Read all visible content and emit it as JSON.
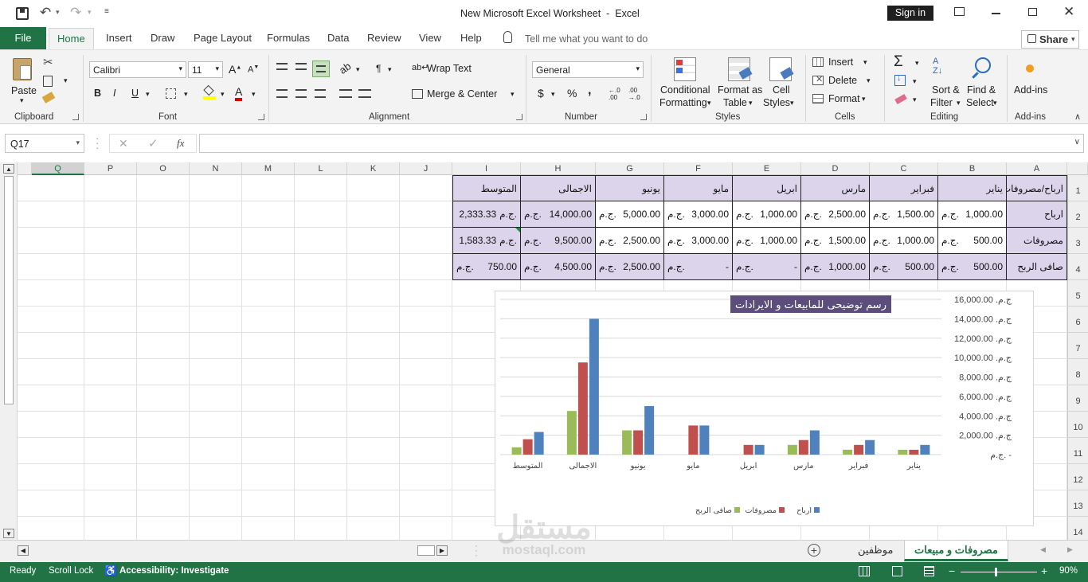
{
  "window": {
    "title": "New Microsoft Excel Worksheet  -  Excel",
    "sign_in": "Sign in"
  },
  "ribbon_tabs": [
    "File",
    "Home",
    "Insert",
    "Draw",
    "Page Layout",
    "Formulas",
    "Data",
    "Review",
    "View",
    "Help"
  ],
  "tell_me": "Tell me what you want to do",
  "share": "Share",
  "ribbon": {
    "clipboard": {
      "paste": "Paste",
      "label": "Clipboard"
    },
    "font": {
      "name": "Calibri",
      "size": "11",
      "label": "Font"
    },
    "alignment": {
      "wrap": "Wrap Text",
      "merge": "Merge & Center",
      "label": "Alignment"
    },
    "number": {
      "format": "General",
      "label": "Number",
      "currency": "$",
      "percent": "%",
      "comma": ","
    },
    "styles": {
      "conditional_1": "Conditional",
      "conditional_2": "Formatting",
      "format_table_1": "Format as",
      "format_table_2": "Table",
      "cell_styles_1": "Cell",
      "cell_styles_2": "Styles",
      "label": "Styles"
    },
    "cells": {
      "insert": "Insert",
      "delete": "Delete",
      "format": "Format",
      "label": "Cells"
    },
    "editing": {
      "sort_1": "Sort &",
      "sort_2": "Filter",
      "find_1": "Find &",
      "find_2": "Select",
      "label": "Editing"
    },
    "addins": {
      "name": "Add-ins",
      "label": "Add-ins"
    }
  },
  "formula_bar": {
    "name_box": "Q17",
    "fx": "fx",
    "value": ""
  },
  "columns": [
    "Q",
    "P",
    "O",
    "N",
    "M",
    "L",
    "K",
    "J",
    "I",
    "H",
    "G",
    "F",
    "E",
    "D",
    "C",
    "B",
    "A"
  ],
  "rows": [
    "1",
    "2",
    "3",
    "4",
    "5",
    "6",
    "7",
    "8",
    "9",
    "10",
    "11",
    "12",
    "13",
    "14"
  ],
  "table": {
    "header": [
      "ارباح/مصروفات",
      "يناير",
      "فبراير",
      "مارس",
      "ابريل",
      "مايو",
      "يونيو",
      "الاجمالى",
      "المتوسط"
    ],
    "rows": [
      {
        "label": "ارباح",
        "values": [
          "1,000.00",
          "1,500.00",
          "2,500.00",
          "1,000.00",
          "3,000.00",
          "5,000.00",
          "14,000.00",
          "2,333.33"
        ]
      },
      {
        "label": "مصروفات",
        "values": [
          "500.00",
          "1,000.00",
          "1,500.00",
          "1,000.00",
          "3,000.00",
          "2,500.00",
          "9,500.00",
          "1,583.33"
        ]
      },
      {
        "label": "صافى الربح",
        "values": [
          "500.00",
          "500.00",
          "1,000.00",
          "-",
          "-",
          "2,500.00",
          "4,500.00",
          "750.00"
        ]
      }
    ],
    "currency": "ج.م."
  },
  "chart_data": {
    "type": "bar",
    "title": "رسم توضيحى للمابيعات و الايرادات",
    "categories": [
      "يناير",
      "فبراير",
      "مارس",
      "ابريل",
      "مايو",
      "يونيو",
      "الاجمالى",
      "المتوسط"
    ],
    "series": [
      {
        "name": "ارباح",
        "color": "#4f81bd",
        "values": [
          1000,
          1500,
          2500,
          1000,
          3000,
          5000,
          14000,
          2333.33
        ]
      },
      {
        "name": "مصروفات",
        "color": "#c0504d",
        "values": [
          500,
          1000,
          1500,
          1000,
          3000,
          2500,
          9500,
          1583.33
        ]
      },
      {
        "name": "صافى الربح",
        "color": "#9bbb59",
        "values": [
          500,
          500,
          1000,
          0,
          0,
          2500,
          4500,
          750
        ]
      }
    ],
    "yticks": [
      "ج.م. 16,000.00",
      "ج.م. 14,000.00",
      "ج.م. 12,000.00",
      "ج.م. 10,000.00",
      "ج.م. 8,000.00",
      "ج.م. 6,000.00",
      "ج.م. 4,000.00",
      "ج.م. 2,000.00",
      "ج.م. -"
    ],
    "ylim": [
      0,
      16000
    ],
    "legend": "bottom",
    "xaxis_reversed": true,
    "yaxis_position": "right"
  },
  "sheet_tabs": [
    "مصروفات و مبيعات",
    "موظفين"
  ],
  "status": {
    "ready": "Ready",
    "scroll_lock": "Scroll Lock",
    "accessibility": "Accessibility: Investigate",
    "zoom": "90%"
  },
  "watermark": {
    "ar": "مستقل",
    "en": "mostaql.com"
  }
}
